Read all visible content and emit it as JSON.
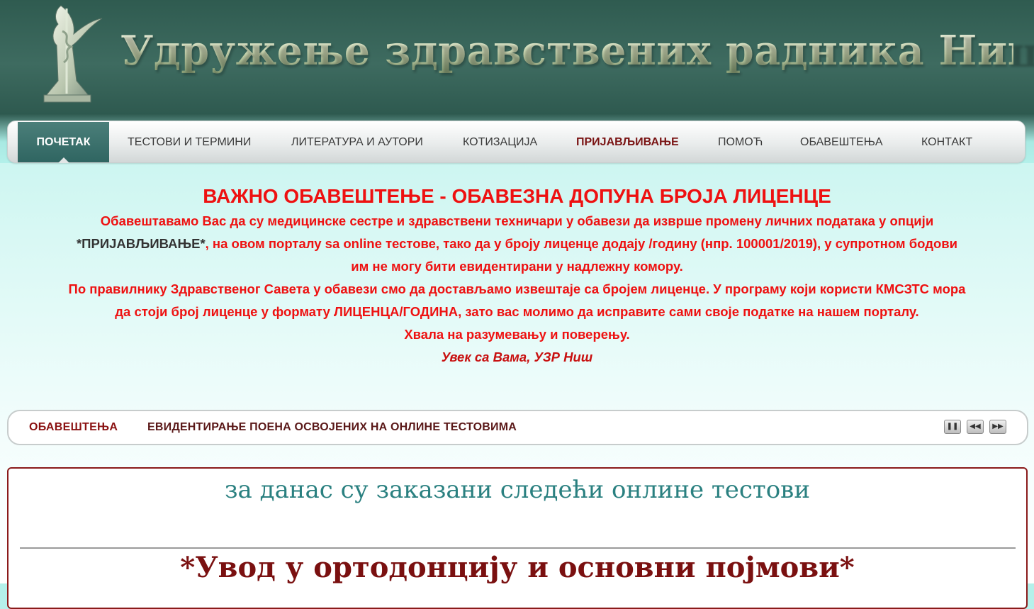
{
  "site": {
    "title": "Удружење здравствених радника Ниш",
    "logo_icon": "caduceus-statue-icon"
  },
  "nav": {
    "items": [
      {
        "label": "ПОЧЕТАК",
        "active": true
      },
      {
        "label": "ТЕСТОВИ И ТЕРМИНИ"
      },
      {
        "label": "ЛИТЕРАТУРА И АУТОРИ"
      },
      {
        "label": "КОТИЗАЦИЈА"
      },
      {
        "label": "ПРИЈАВЉИВАЊЕ",
        "highlight": true
      },
      {
        "label": "ПОМОЋ"
      },
      {
        "label": "ОБАВЕШТЕЊА"
      },
      {
        "label": "КОНТАКТ"
      }
    ]
  },
  "notice": {
    "title": "ВАЖНО ОБАВЕШТЕЊЕ - ОБАВЕЗНА ДОПУНА БРОЈА ЛИЦЕНЦЕ",
    "line1": "Обавештавамо Вас да су медицинске сестре и здравствени техничари у обавези да изврше промену личних података у опцији",
    "line2_link": "*ПРИЈАВЉИВАЊЕ*",
    "line2_rest": ", на овом порталу sa online тестове, тако да у броју лиценце додају /годину (нпр. 100001/2019), у супротном бодови",
    "line3": "им не могу бити евидентирани у надлежну комору.",
    "line4": "По правилнику Здравственог Савета у обавези смо да достављамо извештаје са бројем лиценце. У програму који користи КМСЗТС мора",
    "line5": "да стоји број лиценце у формату ЛИЦЕНЦА/ГОДИНА, зато вас молимо да исправите сами своје податке на нашем порталу.",
    "line6": "Хвала на разумевању и поверењу.",
    "signature": "Увек са Вама, УЗР Ниш"
  },
  "ticker": {
    "label": "ОБАВЕШТЕЊА",
    "text": "ЕВИДЕНТИРАЊЕ ПОЕНА ОСВОЈЕНИХ НА ОНЛИНЕ ТЕСТОВИМА",
    "pause_icon": "pause-icon",
    "prev_icon": "rewind-icon",
    "next_icon": "fast-forward-icon"
  },
  "content": {
    "heading": "за данас су заказани следећи онлине тестови",
    "test_title": "*Увод у ортодонцију и основни појмови*"
  },
  "colors": {
    "header_bg": "#2f5b50",
    "nav_active": "#3f7470",
    "notice_red": "#ee1111",
    "content_border": "#8a1a1a",
    "heading_teal": "#2a8080"
  }
}
